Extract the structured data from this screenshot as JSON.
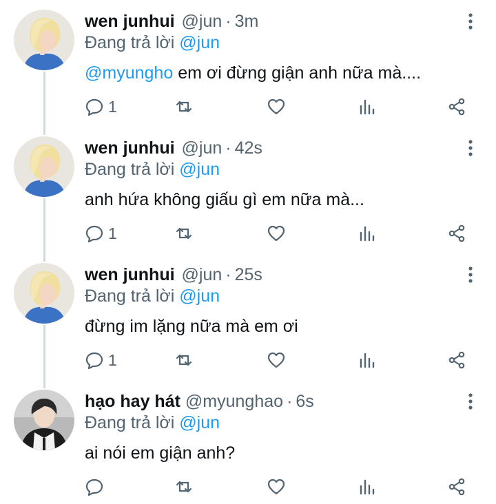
{
  "replying_prefix": "Đang trả lời",
  "colors": {
    "link": "#1d9bf0",
    "secondary": "#536471",
    "thread_line": "#cfd9de"
  },
  "tweets": [
    {
      "name": "wen junhui",
      "handle": "@jun",
      "dot": "·",
      "time": "3m",
      "replying_to": "@jun",
      "mention": "@myungho",
      "text": "em ơi đừng giận anh nữa mà....",
      "reply_count": "1",
      "avatar": "blonde-side-profile-avatar"
    },
    {
      "name": "wen junhui",
      "handle": "@jun",
      "dot": "·",
      "time": "42s",
      "replying_to": "@jun",
      "mention": "",
      "text": "anh hứa không giấu gì em nữa mà...",
      "reply_count": "1",
      "avatar": "blonde-side-profile-avatar"
    },
    {
      "name": "wen junhui",
      "handle": "@jun",
      "dot": "·",
      "time": "25s",
      "replying_to": "@jun",
      "mention": "",
      "text": "đừng im lặng nữa mà em ơi",
      "reply_count": "1",
      "avatar": "blonde-side-profile-avatar"
    },
    {
      "name": "hạo hay hát",
      "handle": "@myunghao",
      "dot": "·",
      "time": "6s",
      "replying_to": "@jun",
      "mention": "",
      "text": "ai nói em giận anh?",
      "reply_count": "",
      "avatar": "dark-hair-jacket-avatar"
    }
  ]
}
